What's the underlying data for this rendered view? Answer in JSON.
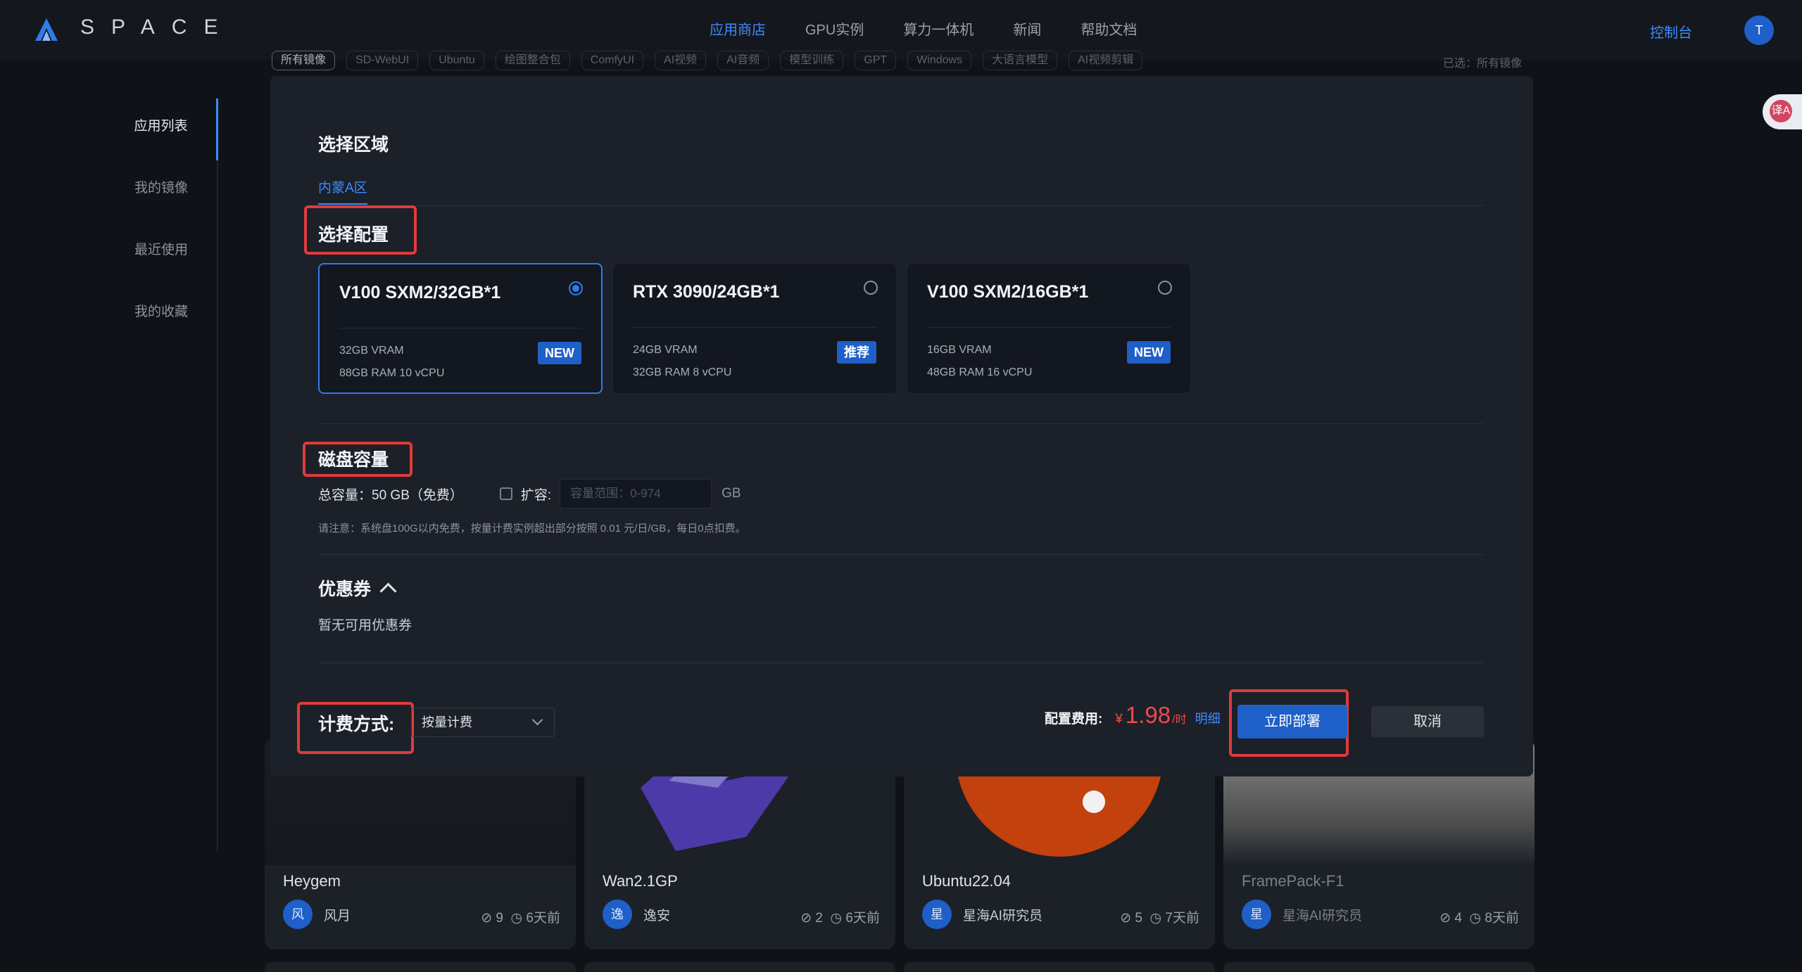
{
  "topbar": {
    "brand": "SPACE",
    "nav": [
      "应用商店",
      "GPU实例",
      "算力一体机",
      "新闻",
      "帮助文档"
    ],
    "active_nav": "应用商店",
    "console": "控制台",
    "user_initial": "T"
  },
  "sidenav": {
    "items": [
      "应用列表",
      "我的镜像",
      "最近使用",
      "我的收藏"
    ],
    "active": "应用列表"
  },
  "filters": {
    "chips": [
      "所有镜像",
      "SD-WebUI",
      "Ubuntu",
      "绘图整合包",
      "ComfyUI",
      "AI视频",
      "AI音频",
      "模型训练",
      "GPT",
      "Windows",
      "大语言模型",
      "AI视频剪辑"
    ],
    "selected_text": "已选：所有镜像"
  },
  "translate_button": "译A",
  "cards": [
    {
      "title": "Heygem",
      "author_initial": "风",
      "author": "风月",
      "uses": "9",
      "time": "6天前"
    },
    {
      "title": "Wan2.1GP",
      "author_initial": "逸",
      "author": "逸安",
      "uses": "2",
      "time": "6天前"
    },
    {
      "title": "Ubuntu22.04",
      "author_initial": "星",
      "author": "星海AI研究员",
      "uses": "5",
      "time": "7天前"
    },
    {
      "title": "FramePack-F1",
      "author_initial": "星",
      "author": "星海AI研究员",
      "uses": "4",
      "time": "8天前"
    }
  ],
  "modal": {
    "region": {
      "title": "选择区域",
      "tab": "内蒙A区"
    },
    "config": {
      "title": "选择配置",
      "selected_index": 0,
      "options": [
        {
          "name": "V100 SXM2/32GB*1",
          "vram": "32GB VRAM",
          "spec": "88GB RAM 10 vCPU",
          "badge": "NEW"
        },
        {
          "name": "RTX 3090/24GB*1",
          "vram": "24GB VRAM",
          "spec": "32GB RAM 8 vCPU",
          "badge": "推荐"
        },
        {
          "name": "V100 SXM2/16GB*1",
          "vram": "16GB VRAM",
          "spec": "48GB RAM 16 vCPU",
          "badge": "NEW"
        }
      ]
    },
    "disk": {
      "title": "磁盘容量",
      "total": "总容量：50 GB（免费）",
      "expand_label": "扩容:",
      "placeholder": "容量范围：0-974",
      "unit": "GB",
      "note": "请注意：系统盘100G以内免费，按量计费实例超出部分按照 0.01 元/日/GB，每日0点扣费。"
    },
    "coupon": {
      "title": "优惠券",
      "empty": "暂无可用优惠券"
    },
    "billing": {
      "label": "计费方式:",
      "value": "按量计费"
    },
    "fee": {
      "label": "配置费用:",
      "currency": "¥",
      "amount": "1.98",
      "unit": "/时",
      "detail": "明细"
    },
    "deploy": "立即部署",
    "cancel": "取消"
  },
  "colors": {
    "accent": "#3d8bff",
    "primary_button": "#1f5fc8",
    "price": "#ef4a4a",
    "highlight_box": "#e03b3b"
  }
}
